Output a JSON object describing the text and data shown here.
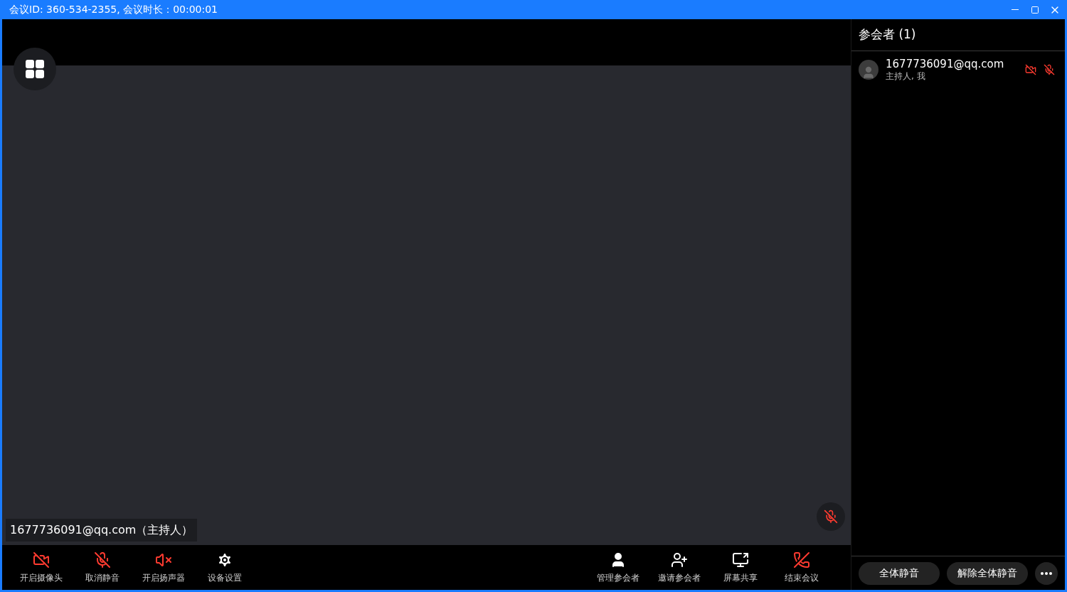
{
  "window": {
    "title": "会议ID: 360-534-2355, 会议时长：00:00:01"
  },
  "video": {
    "label": "1677736091@qq.com（主持人）",
    "mic_muted": true
  },
  "toolbar_left": [
    {
      "kind": "camera",
      "label": "开启摄像头",
      "off": true
    },
    {
      "kind": "mic",
      "label": "取消静音",
      "off": true
    },
    {
      "kind": "speaker",
      "label": "开启扬声器",
      "off": true
    },
    {
      "kind": "settings",
      "label": "设备设置",
      "off": false
    }
  ],
  "toolbar_right": [
    {
      "kind": "manage",
      "label": "管理参会者",
      "off": false
    },
    {
      "kind": "invite",
      "label": "邀请参会者",
      "off": false
    },
    {
      "kind": "share",
      "label": "屏幕共享",
      "off": false
    },
    {
      "kind": "hangup",
      "label": "结束会议",
      "off": true
    }
  ],
  "participants_panel": {
    "title": "参会者 (1)",
    "participants": [
      {
        "name": "1677736091@qq.com",
        "role": "主持人, 我",
        "camera_off": true,
        "mic_muted": true
      }
    ],
    "buttons": [
      "全体静音",
      "解除全体静音"
    ]
  }
}
